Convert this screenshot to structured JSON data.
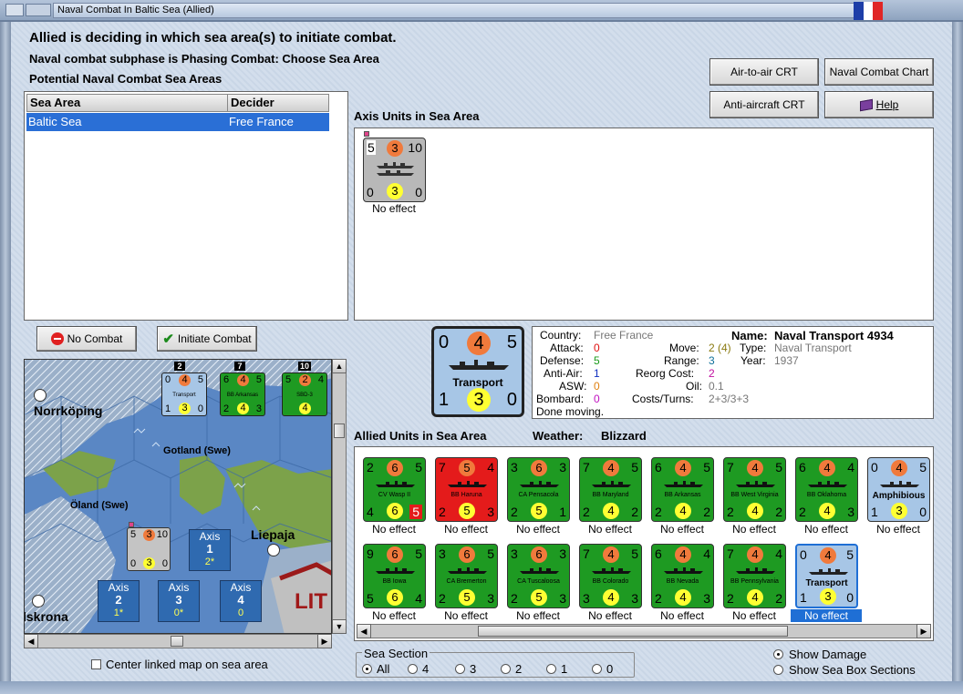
{
  "window": {
    "title": "Naval Combat In Baltic Sea (Allied)"
  },
  "header": {
    "line1": "Allied is deciding in which sea area(s) to initiate combat.",
    "line2": "Naval combat subphase is Phasing Combat: Choose Sea Area",
    "line3": "Potential Naval Combat Sea Areas"
  },
  "table": {
    "columns": [
      "Sea Area",
      "Decider"
    ],
    "rows": [
      [
        "Baltic Sea",
        "Free France"
      ]
    ]
  },
  "buttons": {
    "air_to_air": "Air-to-air CRT",
    "naval_chart": "Naval Combat Chart",
    "anti_aircraft": "Anti-aircraft CRT",
    "help": "Help",
    "no_combat": "No Combat",
    "initiate_combat": "Initiate Combat"
  },
  "axis_panel": {
    "title": "Axis Units in Sea Area",
    "unit": {
      "tl": "5",
      "tc": "3",
      "tr": "10",
      "bl": "0",
      "bc": "3",
      "br": "0",
      "effect": "No effect"
    }
  },
  "selected_unit": {
    "tl": "0",
    "tc": "4",
    "tr": "5",
    "bl": "1",
    "bc": "3",
    "br": "0",
    "name_label": "Transport"
  },
  "details": {
    "country_label": "Country:",
    "country": "Free France",
    "attack_label": "Attack:",
    "attack": "0",
    "defense_label": "Defense:",
    "defense": "5",
    "antiair_label": "Anti-Air:",
    "antiair": "1",
    "asw_label": "ASW:",
    "asw": "0",
    "bombard_label": "Bombard:",
    "bombard": "0",
    "status": "Done moving.",
    "move_label": "Move:",
    "move": "2",
    "move_extra": "(4)",
    "range_label": "Range:",
    "range": "3",
    "reorg_label": "Reorg Cost:",
    "reorg": "2",
    "oil_label": "Oil:",
    "oil": "0.1",
    "costs_label": "Costs/Turns:",
    "costs": "2+3/3+3",
    "name_label": "Name:",
    "name": "Naval Transport 4934",
    "type_label": "Type:",
    "type": "Naval Transport",
    "year_label": "Year:",
    "year": "1937"
  },
  "allied_panel": {
    "title": "Allied Units in Sea Area",
    "weather_label": "Weather:",
    "weather": "Blizzard",
    "units": [
      {
        "tl": "2",
        "tc": "6",
        "tr": "5",
        "bl": "4",
        "bc": "6",
        "br": "5",
        "name": "CV Wasp II",
        "color": "green",
        "effect": "No effect"
      },
      {
        "tl": "7",
        "tc": "5",
        "tr": "4",
        "bl": "2",
        "bc": "5",
        "br": "3",
        "name": "BB Haruna",
        "color": "red",
        "effect": "No effect"
      },
      {
        "tl": "3",
        "tc": "6",
        "tr": "3",
        "bl": "2",
        "bc": "5",
        "br": "1",
        "name": "CA Pensacola",
        "color": "green",
        "effect": "No effect"
      },
      {
        "tl": "7",
        "tc": "4",
        "tr": "5",
        "bl": "2",
        "bc": "4",
        "br": "2",
        "name": "BB Maryland",
        "color": "green",
        "effect": "No effect"
      },
      {
        "tl": "6",
        "tc": "4",
        "tr": "5",
        "bl": "2",
        "bc": "4",
        "br": "2",
        "name": "BB Arkansas",
        "color": "green",
        "effect": "No effect"
      },
      {
        "tl": "7",
        "tc": "4",
        "tr": "5",
        "bl": "2",
        "bc": "4",
        "br": "2",
        "name": "BB West Virginia",
        "color": "green",
        "effect": "No effect"
      },
      {
        "tl": "6",
        "tc": "4",
        "tr": "4",
        "bl": "2",
        "bc": "4",
        "br": "3",
        "name": "BB Oklahoma",
        "color": "green",
        "effect": "No effect"
      },
      {
        "tl": "0",
        "tc": "4",
        "tr": "5",
        "bl": "1",
        "bc": "3",
        "br": "0",
        "name": "Amphibious",
        "color": "blue",
        "effect": "No effect"
      },
      {
        "tl": "9",
        "tc": "6",
        "tr": "5",
        "bl": "5",
        "bc": "6",
        "br": "4",
        "name": "BB Iowa",
        "color": "green",
        "effect": "No effect"
      },
      {
        "tl": "3",
        "tc": "6",
        "tr": "5",
        "bl": "2",
        "bc": "5",
        "br": "3",
        "name": "CA Bremerton",
        "color": "green",
        "effect": "No effect"
      },
      {
        "tl": "3",
        "tc": "6",
        "tr": "3",
        "bl": "2",
        "bc": "5",
        "br": "3",
        "name": "CA Tuscaloosa",
        "color": "green",
        "effect": "No effect"
      },
      {
        "tl": "7",
        "tc": "4",
        "tr": "5",
        "bl": "3",
        "bc": "4",
        "br": "3",
        "name": "BB Colorado",
        "color": "green",
        "effect": "No effect"
      },
      {
        "tl": "6",
        "tc": "4",
        "tr": "4",
        "bl": "2",
        "bc": "4",
        "br": "3",
        "name": "BB Nevada",
        "color": "green",
        "effect": "No effect"
      },
      {
        "tl": "7",
        "tc": "4",
        "tr": "4",
        "bl": "2",
        "bc": "4",
        "br": "2",
        "name": "BB Pennsylvania",
        "color": "green",
        "effect": "No effect"
      },
      {
        "tl": "0",
        "tc": "4",
        "tr": "5",
        "bl": "1",
        "bc": "3",
        "br": "0",
        "name": "Transport",
        "color": "blue",
        "effect": "No effect",
        "selected": true
      }
    ]
  },
  "map": {
    "places": {
      "norrkoping": "Norrköping",
      "gotland": "Gotland (Swe)",
      "oland": "Öland (Swe)",
      "liepaja": "Liepaja",
      "karlskrona": "lskrona",
      "lit": "LIT"
    },
    "stack_counts": [
      "2",
      "7",
      "10"
    ],
    "stack_units": [
      {
        "tl": "0",
        "tc": "4",
        "tr": "5",
        "bl": "1",
        "bc": "3",
        "br": "0",
        "name": "Transport"
      },
      {
        "tl": "6",
        "tc": "4",
        "tr": "5",
        "bl": "2",
        "bc": "4",
        "br": "3",
        "name": "BB Arkansas"
      },
      {
        "tl": "5",
        "tc": "2",
        "tr": "4",
        "bl": "",
        "bc": "4",
        "br": "",
        "name": "SBD-3"
      }
    ],
    "axis_counter": {
      "tl": "5",
      "tc": "3",
      "tr": "10",
      "bl": "0",
      "bc": "3",
      "br": "0"
    },
    "axis_boxes": [
      {
        "label": "Axis",
        "num": "1",
        "val": "2*"
      },
      {
        "label": "Axis",
        "num": "2",
        "val": "1*"
      },
      {
        "label": "Axis",
        "num": "3",
        "val": "0*"
      },
      {
        "label": "Axis",
        "num": "4",
        "val": "0"
      }
    ]
  },
  "center_linked_label": "Center linked map on sea area",
  "sea_section": {
    "title": "Sea Section",
    "options": [
      "All",
      "4",
      "3",
      "2",
      "1",
      "0"
    ],
    "selected": "All"
  },
  "display_options": [
    "Show Damage",
    "Show Sea Box Sections"
  ],
  "colors": {
    "green": "#1e9a22",
    "red": "#e41b1b",
    "blue": "#a7c6e6",
    "selection": "#2a6fd6"
  }
}
